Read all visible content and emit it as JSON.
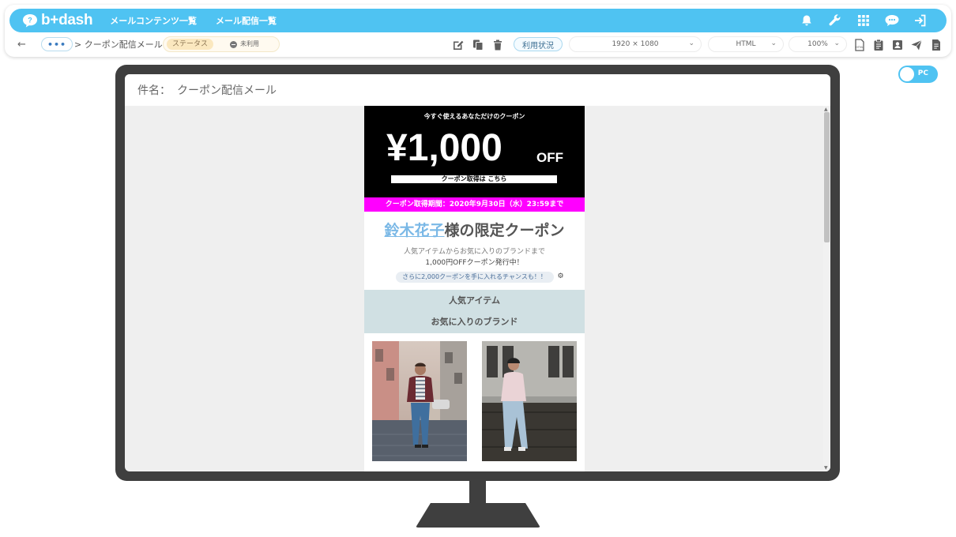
{
  "app": {
    "logo_text": "b+dash",
    "nav": [
      "メールコンテンツ一覧",
      "メール配信一覧"
    ],
    "top_icons": [
      "bell-icon",
      "wrench-icon",
      "grid-icon",
      "chat-icon",
      "logout-icon"
    ],
    "brand_color": "#4fc3f2"
  },
  "toolbar": {
    "back_label": "←",
    "more_label": "•••",
    "breadcrumb": "> クーポン配信メール",
    "status_label": "ステータス",
    "status_value": "未利用",
    "usage_button": "利用状況",
    "resolution": "1920 × 1080",
    "format": "HTML",
    "zoom": "100%",
    "edit_icons": [
      "edit-icon",
      "copy-icon",
      "trash-icon"
    ],
    "right_icons": [
      "html-file-icon",
      "clipboard-icon",
      "contact-icon",
      "send-icon",
      "document-icon"
    ]
  },
  "toggle": {
    "label": "PC",
    "on": true
  },
  "subject": {
    "label": "件名：",
    "value": "クーポン配信メール"
  },
  "email": {
    "hero_subtitle": "今すぐ使えるあなただけのクーポン",
    "price": "¥1,000",
    "off": "OFF",
    "cta": "クーポン取得は こちら",
    "period": "クーポン取得期間：2020年9月30日（水）23:59まで",
    "greeting_name": "鈴木花子",
    "greeting_suffix": "様の限定クーポン",
    "desc_line1": "人気アイテムからお気に入りのブランドまで",
    "desc_line2": "1,000円OFFクーポン発行中！",
    "chance": "さらに2,000クーポンを手に入れるチャンスも！！",
    "categories": [
      "人気アイテム",
      "お気に入りのブランド"
    ],
    "accent_magenta": "#ff00ff",
    "category_bg": "#d0e0e3"
  }
}
